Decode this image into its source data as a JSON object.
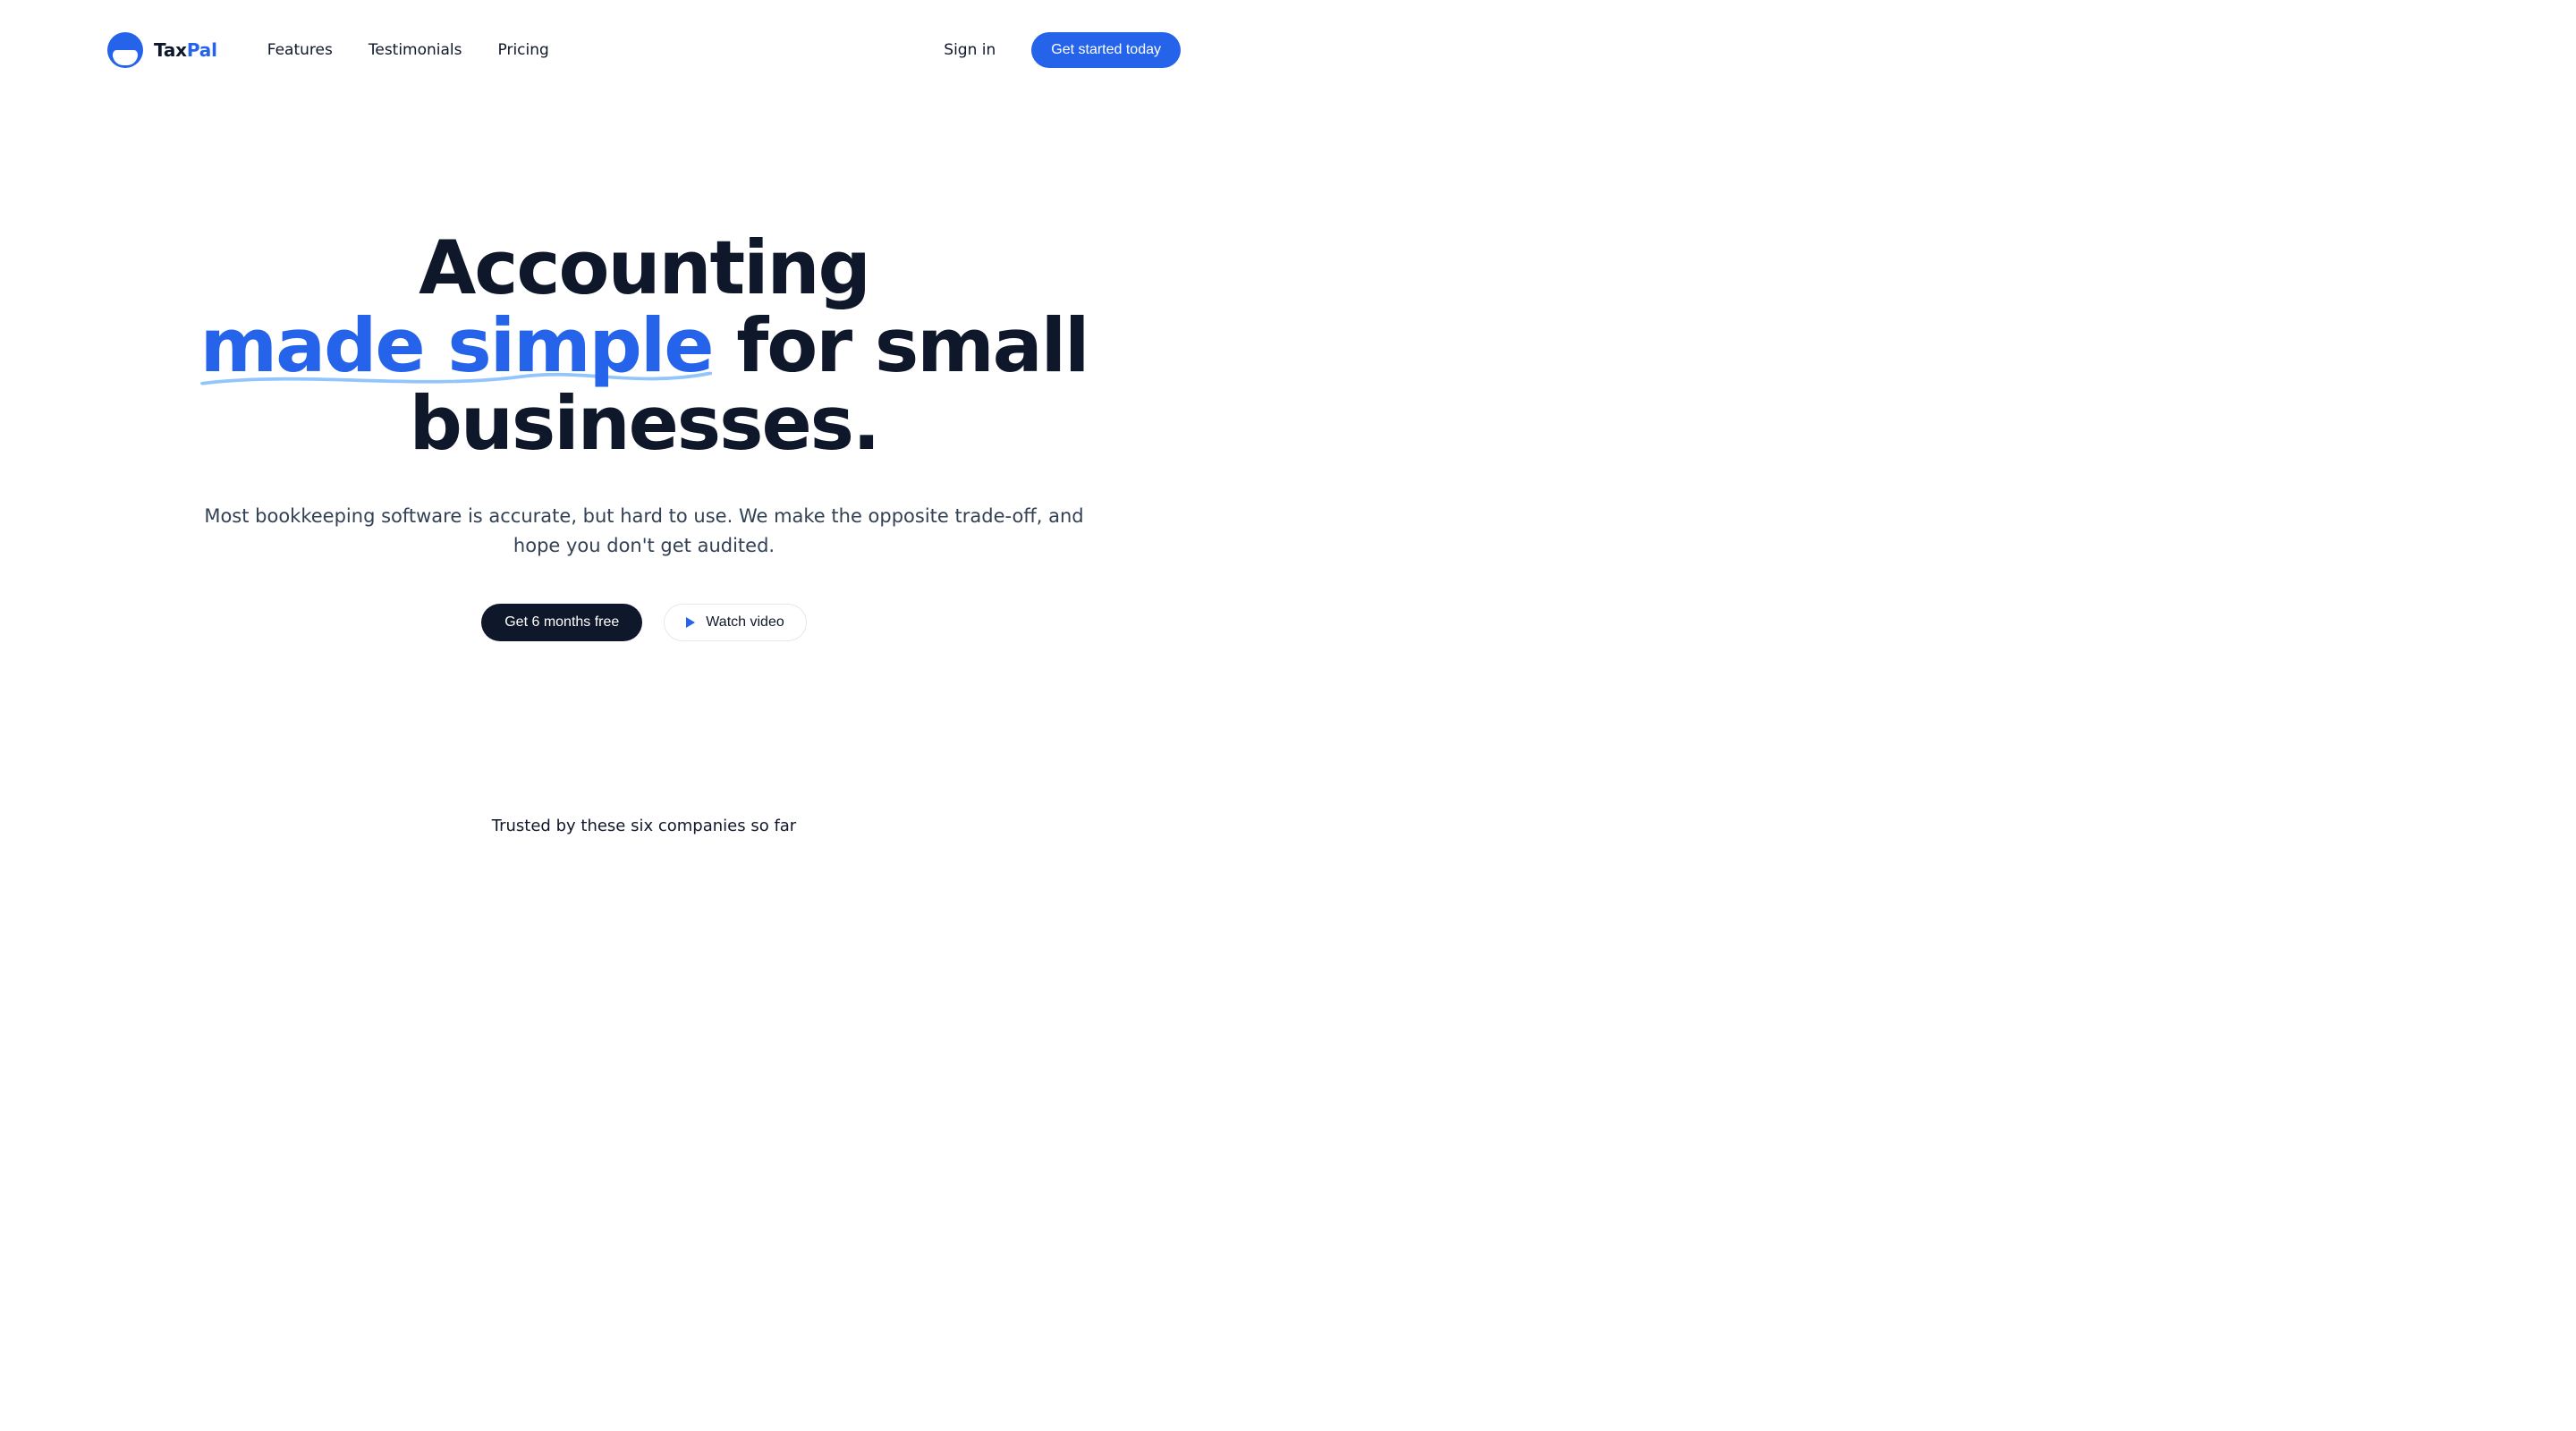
{
  "brand": {
    "name_dark": "Tax",
    "name_accent": "Pal"
  },
  "nav": {
    "items": [
      {
        "label": "Features"
      },
      {
        "label": "Testimonials"
      },
      {
        "label": "Pricing"
      }
    ],
    "signin": "Sign in",
    "cta": "Get started today"
  },
  "hero": {
    "heading_pre": "Accounting ",
    "heading_highlight": "made simple",
    "heading_post": " for small businesses.",
    "subtitle": "Most bookkeeping software is accurate, but hard to use. We make the opposite trade-off, and hope you don't get audited.",
    "cta_primary": "Get 6 months free",
    "cta_video": "Watch video"
  },
  "trusted": {
    "text": "Trusted by these six companies so far"
  },
  "colors": {
    "brand": "#2563eb",
    "dark": "#0f172a"
  }
}
